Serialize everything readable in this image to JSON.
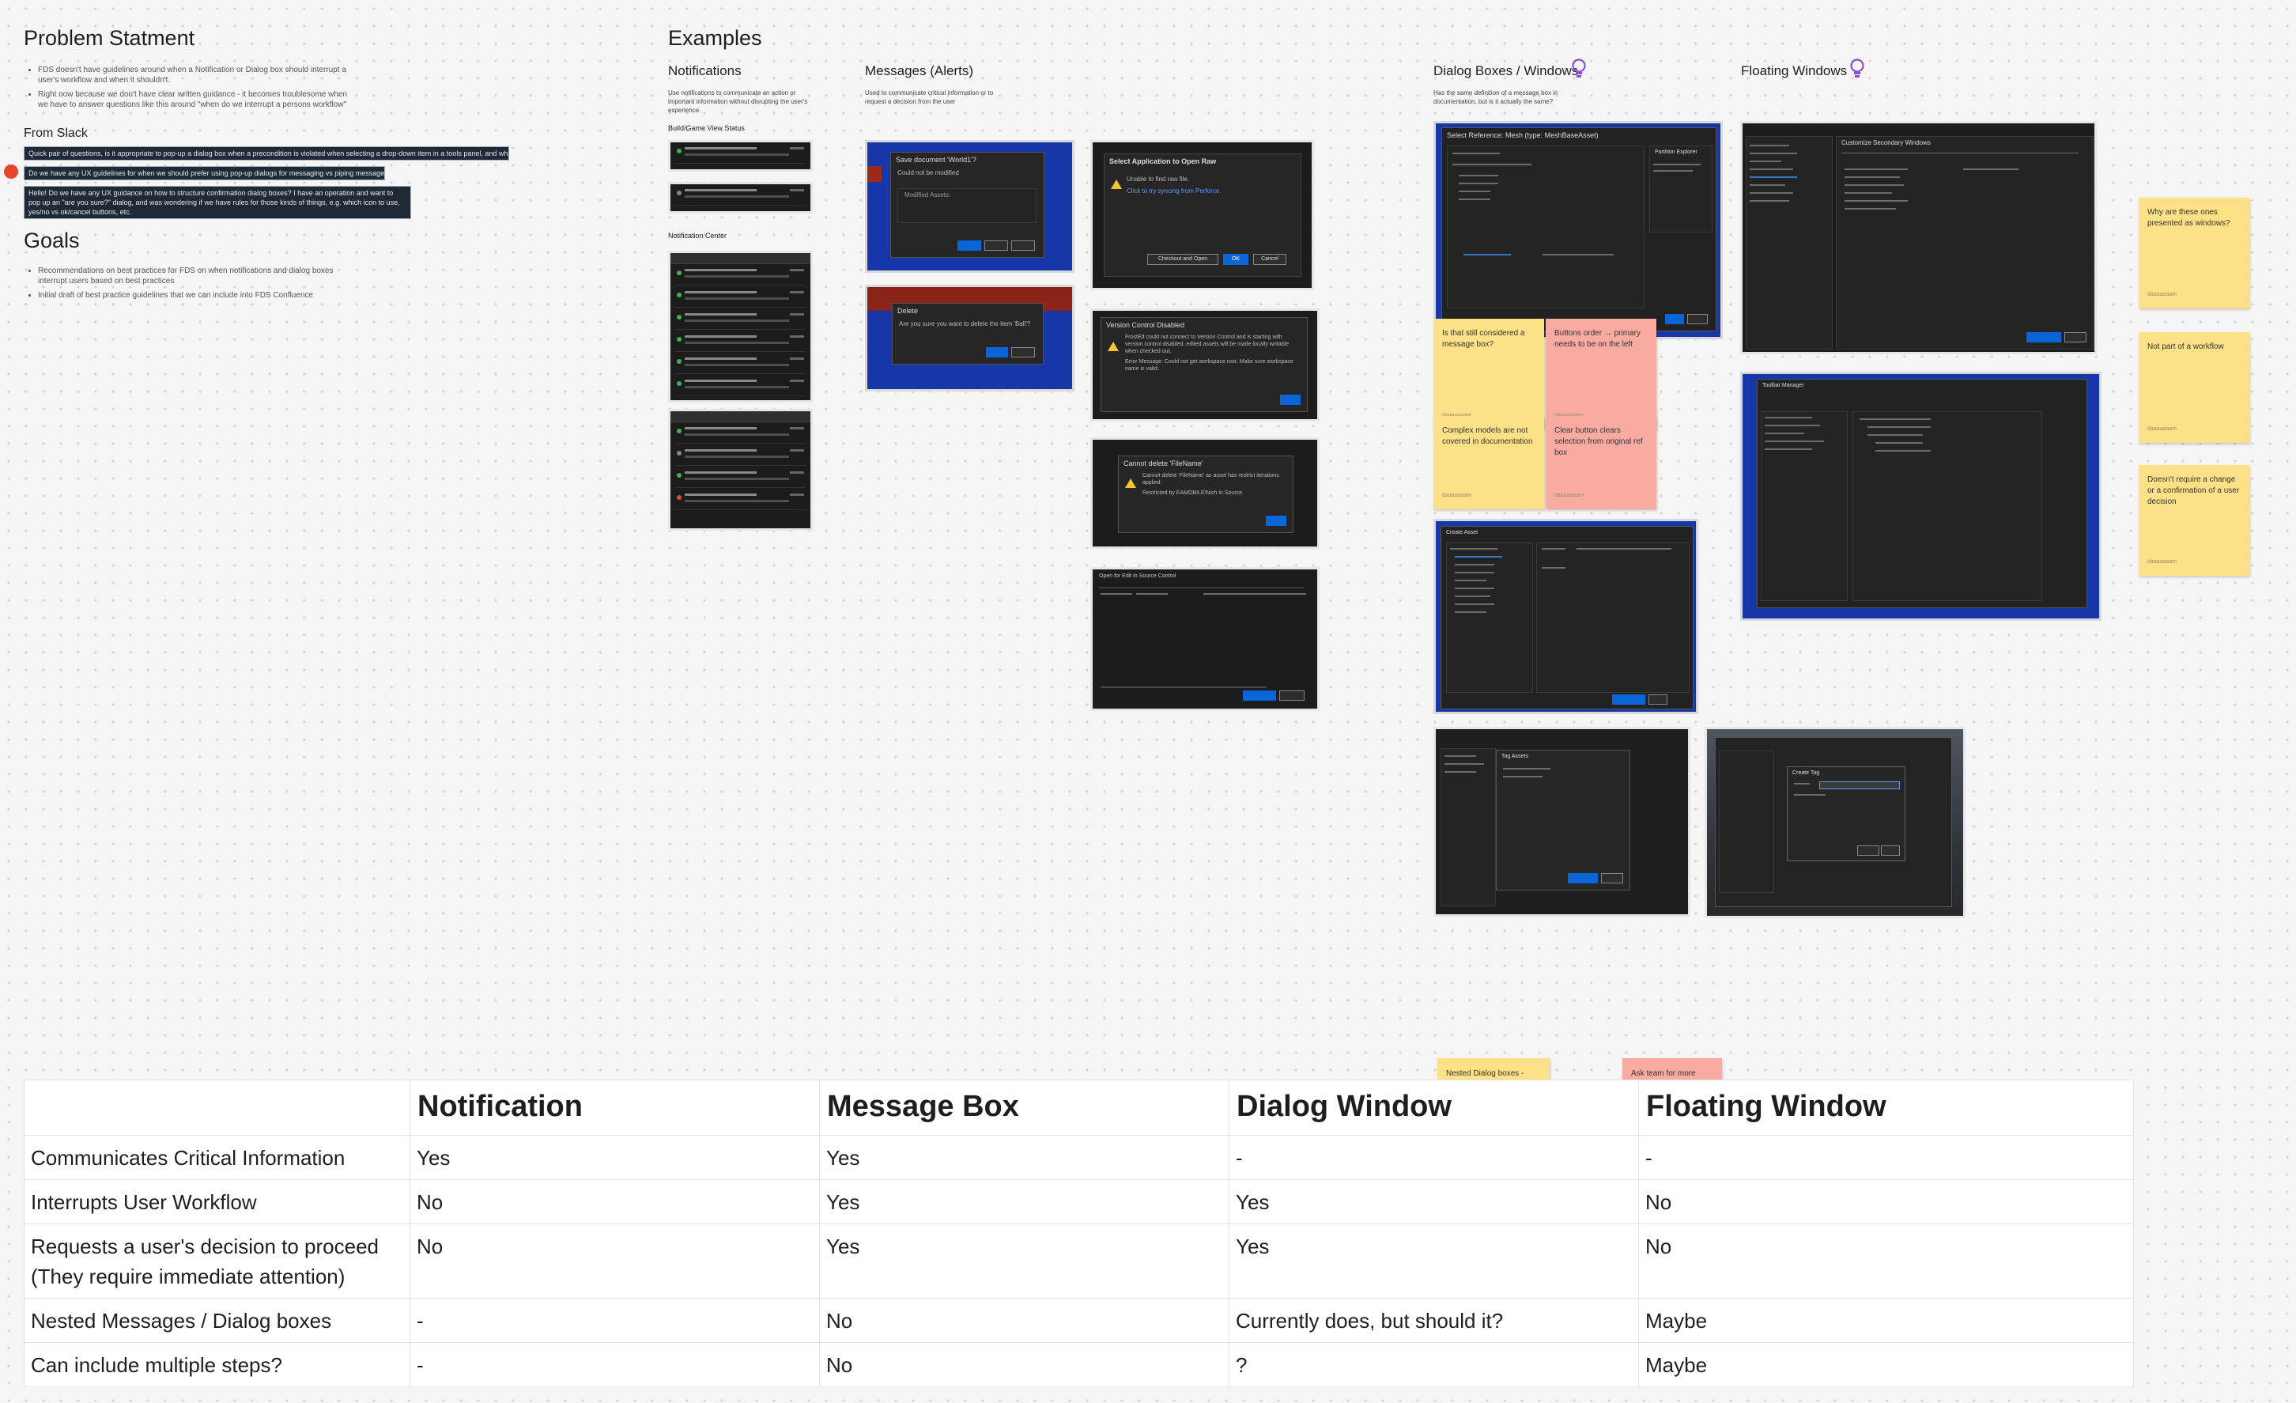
{
  "problem": {
    "title": "Problem Statment",
    "bullets": [
      "FDS doesn't have guidelines around when a Notification or Dialog box should interrupt a user's workflow and when it shouldn't.",
      "Right now because we don't have clear written guidance - it becomes troublesome when we have to answer questions like this around \"when do we interrupt a persons workflow\""
    ]
  },
  "slack": {
    "title": "From Slack",
    "messages": [
      "Quick pair of questions, is it appropriate to pop-up a dialog box when a precondition is violated when selecting a drop-down item in a tools panel, and what is the function to do so? 🙂",
      "Do we have any UX guidelines for when we should prefer using pop-up dialogs for messaging vs piping messages to the general log?",
      "Hello! Do we have any UX guidance on how to structure confirmation dialog boxes? I have an operation and want to pop up an \"are you sure?\" dialog, and was wondering if we have rules for those kinds of things, e.g. which icon to use, yes/no vs ok/cancel buttons, etc."
    ]
  },
  "goals": {
    "title": "Goals",
    "bullets": [
      "Recommendations on best practices for FDS on when notifications and dialog boxes interrupt users based on best practices",
      "Initial draft of best practice guidelines that we can include into FDS Confluence"
    ]
  },
  "examples": {
    "title": "Examples",
    "notifications": {
      "title": "Notifications",
      "desc": "Use notifications to communicate an action or important information without disrupting the user's experience.",
      "build_status_label": "Build/Game View Status",
      "center_label": "Notification Center"
    },
    "messages": {
      "title": "Messages (Alerts)",
      "desc": "Used to communicate critical information or to request a decision from the user"
    },
    "dialogs": {
      "title": "Dialog Boxes / Windows",
      "desc": "Has the same definition of a message box in documentation, but is it actually the same?"
    },
    "floating": {
      "title": "Floating Windows"
    }
  },
  "screens": {
    "save_doc": {
      "title": "Save document 'World1'?",
      "body": "Could not be modified",
      "modified": "Modified Assets:"
    },
    "delete": {
      "title": "Delete",
      "body": "Are you sure you want to delete the item 'Ball'?"
    },
    "open_raw": {
      "title": "Select Application to Open Raw",
      "line1": "Unable to find raw file.",
      "line2": "Click to try syncing from Perforce.",
      "btn1": "Checkout and Open",
      "btn2": "OK",
      "btn3": "Cancel"
    },
    "vc_disabled": {
      "title": "Version Control Disabled",
      "body": "FrostEd could not connect to Version Control and is starting with version control disabled, edited assets will be made locally writable when checked out.",
      "error": "Error Message: Could not get workspace root. Make sure workspace name is valid."
    },
    "cannot_delete": {
      "title": "Cannot delete 'FileName'",
      "body": "Cannot delete 'FileName' as asset has restrict iterations applied.",
      "restricted": "Restricted by EAMOBILE\\Nich in Source."
    },
    "open_edit": {
      "title": "Open for Edit in Source Control",
      "btn": "Open for Edit"
    },
    "select_ref": {
      "title": "Select Reference: Mesh (type: MeshBaseAsset)",
      "panel": "Partition Explorer"
    },
    "create_asset": {
      "title": "Create Asset"
    },
    "ctool": {
      "title": "Customize Secondary Windows"
    },
    "toolbar_mgr": {
      "title": "Toolbar Manager"
    },
    "tag_assets": {
      "title": "Tag Assets"
    },
    "create_tag": {
      "title": "Create Tag"
    }
  },
  "stickies": [
    {
      "text": "Is that still considered a message box?",
      "author": "daaaaaaam",
      "color": "yellow"
    },
    {
      "text": "Buttons order → primary needs to be on the left",
      "author": "daaaaaaam",
      "color": "pink"
    },
    {
      "text": "Complex models are not covered in documentation",
      "author": "daaaaaaam",
      "color": "yellow"
    },
    {
      "text": "Clear button clears selection from original ref box",
      "author": "daaaaaaam",
      "color": "pink"
    },
    {
      "text": "Why are these ones presented as windows?",
      "author": "daaaaaaam",
      "color": "yellow"
    },
    {
      "text": "Not part of a workflow",
      "author": "daaaaaaam",
      "color": "yellow"
    },
    {
      "text": "Doesn't require a change or a confirmation of a user decision",
      "author": "daaaaaaam",
      "color": "yellow"
    },
    {
      "text": "Nested Dialog boxes -",
      "author": "",
      "color": "yellow"
    },
    {
      "text": "Ask team for more",
      "author": "",
      "color": "pink"
    }
  ],
  "table": {
    "headers": [
      "",
      "Notification",
      "Message Box",
      "Dialog Window",
      "Floating Window"
    ],
    "rows": [
      [
        "Communicates Critical Information",
        "Yes",
        "Yes",
        "-",
        "-"
      ],
      [
        "Interrupts User Workflow",
        "No",
        "Yes",
        "Yes",
        "No"
      ],
      [
        "Requests a user's decision to proceed (They require immediate attention)",
        "No",
        "Yes",
        "Yes",
        "No"
      ],
      [
        "Nested Messages / Dialog boxes",
        "-",
        "No",
        "Currently does, but should it?",
        "Maybe"
      ],
      [
        "Can include multiple steps?",
        "-",
        "No",
        "?",
        "Maybe"
      ]
    ]
  },
  "colors": {
    "sticky_yellow": "#fde187",
    "sticky_pink": "#f9aba2",
    "primary_button": "#0a66d8",
    "comment_pin": "#e8452c",
    "bulb_icon": "#8a4fd6"
  }
}
